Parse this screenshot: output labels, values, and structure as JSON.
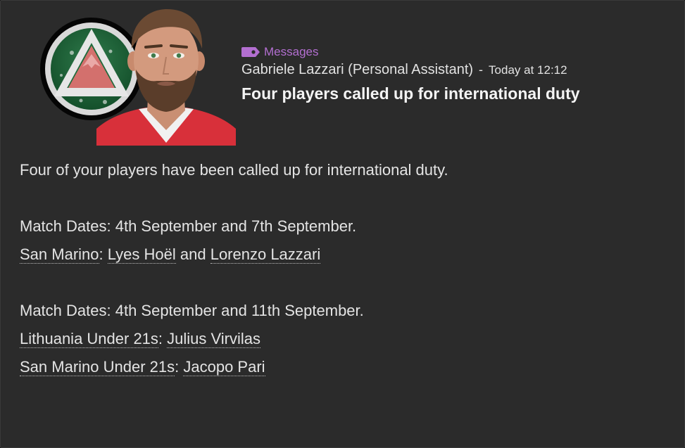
{
  "header": {
    "category": "Messages",
    "sender": "Gabriele Lazzari (Personal Assistant)",
    "separator": "-",
    "time": "Today at 12:12",
    "subject": "Four players called up for international duty"
  },
  "body": {
    "intro": "Four of your players have been called up for international duty.",
    "groups": [
      {
        "dates": "Match Dates: 4th September and 7th September.",
        "rows": [
          {
            "team": "San Marino",
            "colon": ": ",
            "players": [
              "Lyes Hoël",
              "Lorenzo Lazzari"
            ],
            "joiner": " and "
          }
        ]
      },
      {
        "dates": "Match Dates: 4th September and 11th September.",
        "rows": [
          {
            "team": "Lithuania Under 21s",
            "colon": ": ",
            "players": [
              "Julius Virvilas"
            ]
          },
          {
            "team": "San Marino Under 21s",
            "colon": ": ",
            "players": [
              "Jacopo Pari"
            ]
          }
        ]
      }
    ]
  },
  "icons": {
    "tag": "tag-icon",
    "badge": "club-badge-icon",
    "portrait": "assistant-portrait"
  },
  "colors": {
    "background": "#2b2b2b",
    "category": "#b36fd1",
    "text": "#e4e4e4"
  }
}
